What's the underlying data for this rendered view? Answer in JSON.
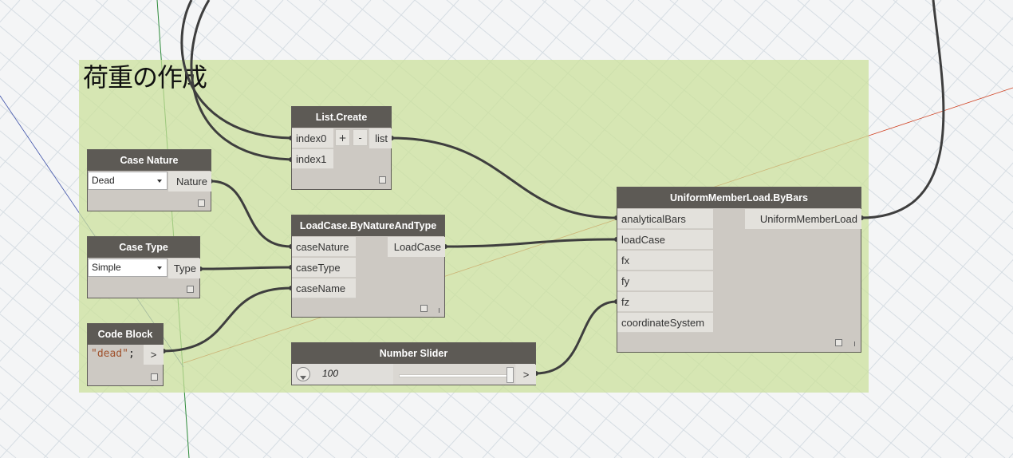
{
  "canvas": {
    "background": "#f4f5f6",
    "grid_color": "#d6dde3",
    "group_color": "#cbe098"
  },
  "group": {
    "title": "荷重の作成"
  },
  "nodes": {
    "list_create": {
      "title": "List.Create",
      "inputs": [
        "index0",
        "index1"
      ],
      "output": "list",
      "add_label": "+",
      "remove_label": "-"
    },
    "case_nature": {
      "title": "Case Nature",
      "selected": "Dead",
      "output": "Nature"
    },
    "case_type": {
      "title": "Case Type",
      "selected": "Simple",
      "output": "Type"
    },
    "code_block": {
      "title": "Code Block",
      "code_string": "\"dead\"",
      "code_suffix": ";",
      "output": ">"
    },
    "loadcase": {
      "title": "LoadCase.ByNatureAndType",
      "inputs": [
        "caseNature",
        "caseType",
        "caseName"
      ],
      "output": "LoadCase"
    },
    "number_slider": {
      "title": "Number Slider",
      "value": "100",
      "level": 1.0,
      "output": ">"
    },
    "uniform_load": {
      "title": "UniformMemberLoad.ByBars",
      "inputs": [
        "analyticalBars",
        "loadCase",
        "fx",
        "fy",
        "fz",
        "coordinateSystem"
      ],
      "output": "UniformMemberLoad"
    }
  }
}
